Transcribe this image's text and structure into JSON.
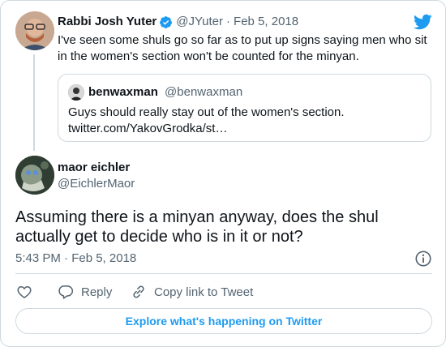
{
  "parent_tweet": {
    "author_name": "Rabbi Josh Yuter",
    "handle": "@JYuter",
    "separator": "·",
    "date": "Feb 5, 2018",
    "text": "I've seen some shuls go so far as to put up signs saying men who sit in the women's section won't be counted for the minyan.",
    "quoted": {
      "author_name": "benwaxman",
      "handle": "@benwaxman",
      "text_line1": "Guys should really stay out of the women's section.",
      "text_line2": "twitter.com/YakovGrodka/st…"
    }
  },
  "main_tweet": {
    "author_name": "maor eichler",
    "handle": "@EichlerMaor",
    "text": "Assuming there is a minyan anyway, does the shul actually get to decide who is in it or not?",
    "timestamp": "5:43 PM · Feb 5, 2018"
  },
  "actions": {
    "reply_label": "Reply",
    "copy_label": "Copy link to Tweet"
  },
  "explore_label": "Explore what's happening on Twitter",
  "colors": {
    "accent": "#1d9bf0",
    "border": "#cfd9de",
    "muted": "#536471",
    "text": "#0f1419"
  },
  "icons": [
    "verified-badge-icon",
    "twitter-bird-icon",
    "info-icon",
    "heart-icon",
    "reply-icon",
    "link-icon"
  ]
}
